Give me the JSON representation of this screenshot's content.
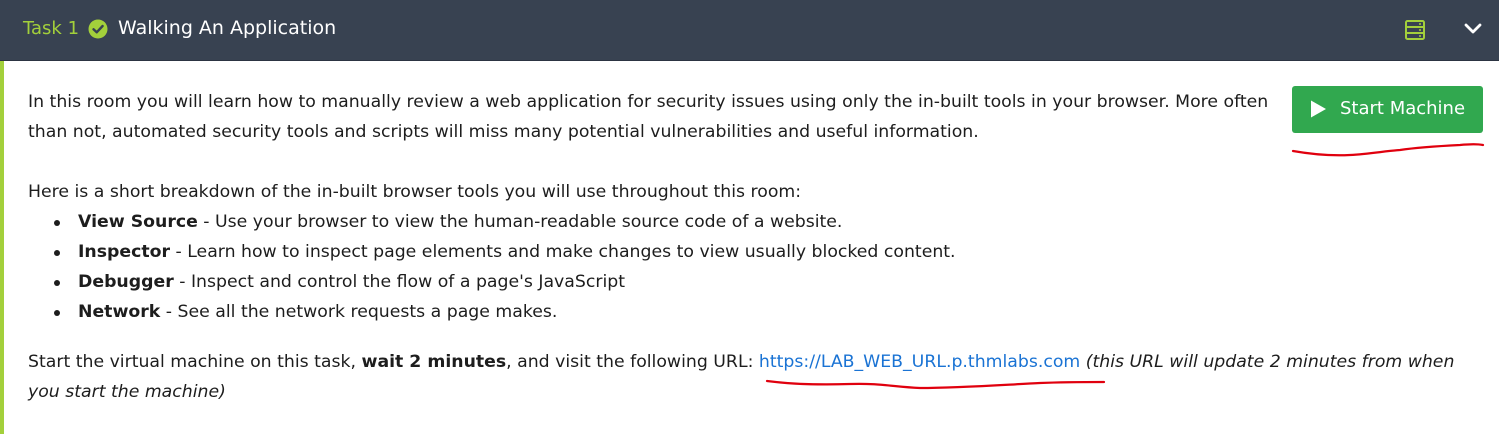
{
  "header": {
    "task_label": "Task 1",
    "title": "Walking An Application",
    "accent_color": "#a3d03b",
    "background_color": "#384251"
  },
  "icons": {
    "status": "check-circle-icon",
    "split_view": "split-view-icon",
    "collapse": "chevron-down-icon",
    "play": "play-icon"
  },
  "start_button": {
    "label": "Start Machine",
    "color": "#31a84f"
  },
  "intro": "In this room you will learn how to manually review a web application for security issues using only the in-built tools in your browser. More often than not, automated security tools and scripts will miss many potential vulnerabilities and useful information.",
  "breakdown_intro": "Here is a short breakdown of the in-built browser tools you will use throughout this room:",
  "tools": [
    {
      "name": "View Source",
      "desc": " - Use your browser to view the human-readable source code of a website."
    },
    {
      "name": "Inspector",
      "desc": " - Learn how to inspect page elements and make changes to view usually blocked content."
    },
    {
      "name": "Debugger",
      "desc": " - Inspect and control the flow of a page's JavaScript"
    },
    {
      "name": "Network",
      "desc": " - See all the network requests a page makes."
    }
  ],
  "instruction": {
    "prefix": "Start the virtual machine on this task, ",
    "bold": "wait 2 minutes",
    "middle": ", and visit the following URL: ",
    "url": "https://LAB_WEB_URL.p.thmlabs.com",
    "note": " (this URL will update 2 minutes from when you start the machine)"
  },
  "annotation_color": "#e0000e"
}
